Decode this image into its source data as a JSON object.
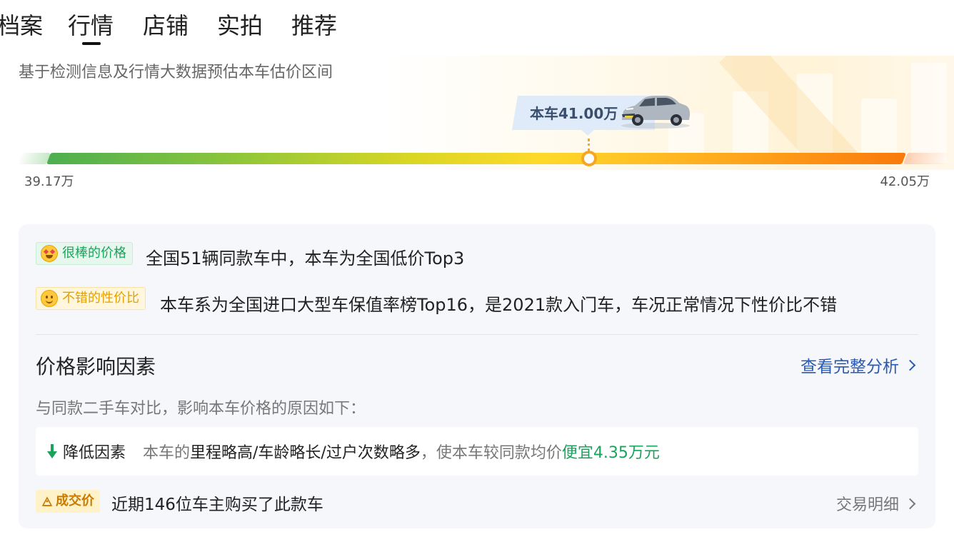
{
  "tabs": [
    {
      "label": "档案"
    },
    {
      "label": "行情"
    },
    {
      "label": "店铺"
    },
    {
      "label": "实拍"
    },
    {
      "label": "推荐"
    }
  ],
  "active_tab": "行情",
  "valuation": {
    "subtitle": "基于检测信息及行情大数据预估本车估价区间",
    "current_price_label": "本车41.00万",
    "range_low_label": "39.17万",
    "range_high_label": "42.05万",
    "range_low": 39.17,
    "range_high": 42.05,
    "current_price": 41.0
  },
  "highlights": [
    {
      "badge": "很棒的价格",
      "icon": "star-struck-emoji-icon",
      "text": "全国51辆同款车中，本车为全国低价Top3"
    },
    {
      "badge": "不错的性价比",
      "icon": "smile-emoji-icon",
      "text": "本车系为全国进口大型车保值率榜Top16，是2021款入门车，车况正常情况下性价比不错"
    }
  ],
  "factors": {
    "title": "价格影响因素",
    "link": "查看完整分析",
    "description": "与同款二手车对比，影响本车价格的原因如下：",
    "item": {
      "label": "降低因素",
      "prefix": "本车的",
      "reasons": "里程略高/车龄略长/过户次数略多",
      "middle": "，使本车较同款均价",
      "result": "便宜4.35万元"
    }
  },
  "deals": {
    "badge": "成交价",
    "text": "近期146位车主购买了此款车",
    "link": "交易明细"
  },
  "colors": {
    "accent_blue": "#2a5ab1",
    "good_green": "#1aa35d",
    "warn_orange": "#f5a623",
    "card_bg": "#f6f7fb"
  }
}
